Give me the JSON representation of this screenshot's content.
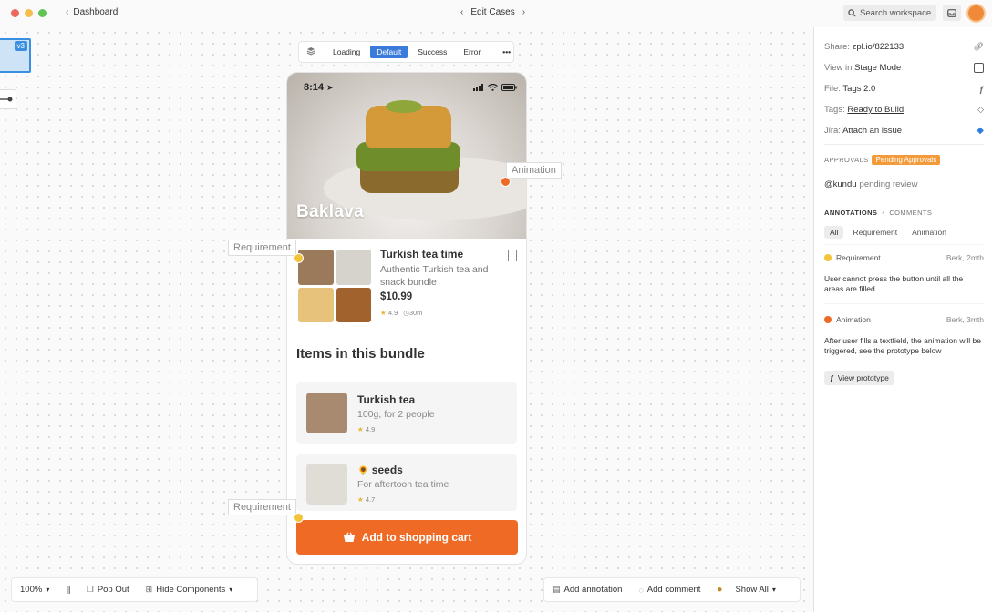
{
  "window": {
    "back_label": "Dashboard",
    "title": "Edit Cases",
    "search_placeholder": "Search workspace"
  },
  "canvas": {
    "version_badge": "v3",
    "states": [
      "Loading",
      "Default",
      "Success",
      "Error"
    ],
    "active_state": "Default",
    "more_label": "•••"
  },
  "phone": {
    "status_time": "8:14",
    "hero_title": "Baklava",
    "product": {
      "title": "Turkish tea time",
      "description": "Authentic Turkish tea and snack bundle",
      "price": "$10.99",
      "rating": "4.9",
      "duration": "30m"
    },
    "section_title": "Items in this bundle",
    "items": [
      {
        "name": "Turkish tea",
        "desc": "100g, for 2 people",
        "rating": "4.9"
      },
      {
        "name": "seeds",
        "emoji": "🌻",
        "desc": "For aftertoon tea time",
        "rating": "4.7"
      }
    ],
    "cart_button": "Add to shopping cart"
  },
  "annotations_canvas": {
    "requirement_label": "Requirement",
    "animation_label": "Animation"
  },
  "bottom_bar": {
    "zoom": "100%",
    "pop_out": "Pop Out",
    "hide_components": "Hide Components",
    "add_annotation": "Add annotation",
    "add_comment": "Add comment",
    "show_all": "Show All"
  },
  "panel": {
    "share_label": "Share:",
    "share_value": "zpl.io/822133",
    "view_label": "View in",
    "view_value": "Stage Mode",
    "file_label": "File:",
    "file_value": "Tags 2.0",
    "tags_label": "Tags:",
    "tags_value": "Ready to Build",
    "jira_label": "Jira:",
    "jira_value": "Attach an issue",
    "approvals_heading": "APPROVALS",
    "approvals_status": "Pending Approvals",
    "reviewer": "@kundu",
    "reviewer_status": "pending review",
    "annotations_tab": "ANNOTATIONS",
    "comments_tab": "COMMENTS",
    "filters": [
      "All",
      "Requirement",
      "Animation"
    ],
    "comments": [
      {
        "type": "Requirement",
        "author": "Berk, 2mth",
        "text": "User cannot press the button until all the areas are filled.",
        "color": "#f3c33a"
      },
      {
        "type": "Animation",
        "author": "Berk, 3mth",
        "text": "After user fills a textfield, the animation will be triggered, see the prototype below",
        "color": "#ec6a25"
      }
    ],
    "view_prototype": "View prototype"
  }
}
